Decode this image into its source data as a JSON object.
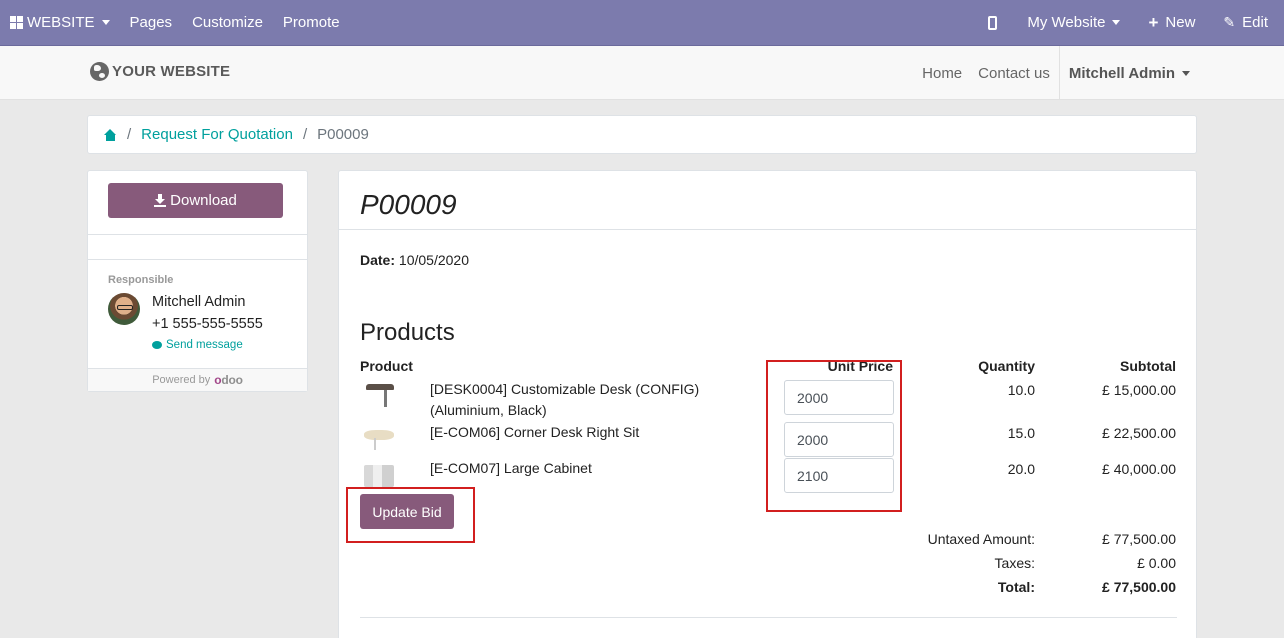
{
  "topbar": {
    "website_label": "WEBSITE",
    "pages_label": "Pages",
    "customize_label": "Customize",
    "promote_label": "Promote",
    "my_website_label": "My Website",
    "new_label": "New",
    "edit_label": "Edit"
  },
  "header": {
    "logo_text": "YOUR WEBSITE",
    "nav": [
      "Home",
      "Contact us"
    ],
    "user_name": "Mitchell Admin"
  },
  "breadcrumb": {
    "separator": "/",
    "items": [
      "Request For Quotation",
      "P00009"
    ]
  },
  "sidebar": {
    "download_label": "Download",
    "responsible_label": "Responsible",
    "responsible_name": "Mitchell Admin",
    "responsible_phone": "+1 555-555-5555",
    "send_message_label": "Send message",
    "powered_by_label": "Powered by",
    "odoo_brand": "odoo"
  },
  "document": {
    "title": "P00009",
    "date_label": "Date:",
    "date_value": "10/05/2020",
    "products_heading": "Products",
    "columns": {
      "product": "Product",
      "unit_price": "Unit Price",
      "quantity": "Quantity",
      "subtotal": "Subtotal"
    },
    "lines": [
      {
        "name": "[DESK0004] Customizable Desk (CONFIG) (Aluminium, Black)",
        "unit_price": "2000",
        "quantity": "10.0",
        "subtotal": "£ 15,000.00"
      },
      {
        "name": "[E-COM06] Corner Desk Right Sit",
        "unit_price": "2000",
        "quantity": "15.0",
        "subtotal": "£ 22,500.00"
      },
      {
        "name": "[E-COM07] Large Cabinet",
        "unit_price": "2100",
        "quantity": "20.0",
        "subtotal": "£ 40,000.00"
      }
    ],
    "update_bid_label": "Update Bid",
    "totals": {
      "untaxed_label": "Untaxed Amount:",
      "untaxed_value": "£ 77,500.00",
      "taxes_label": "Taxes:",
      "taxes_value": "£ 0.00",
      "total_label": "Total:",
      "total_value": "£ 77,500.00"
    }
  },
  "colors": {
    "topbar_bg": "#7c7bad",
    "primary_button": "#875a7b",
    "link_teal": "#00a09d",
    "highlight_red": "#d21f1f"
  },
  "icons": [
    "apps-grid-icon",
    "mobile-phone-icon",
    "plus-icon",
    "pencil-icon",
    "globe-icon",
    "home-icon",
    "download-icon",
    "chat-bubble-icon"
  ]
}
